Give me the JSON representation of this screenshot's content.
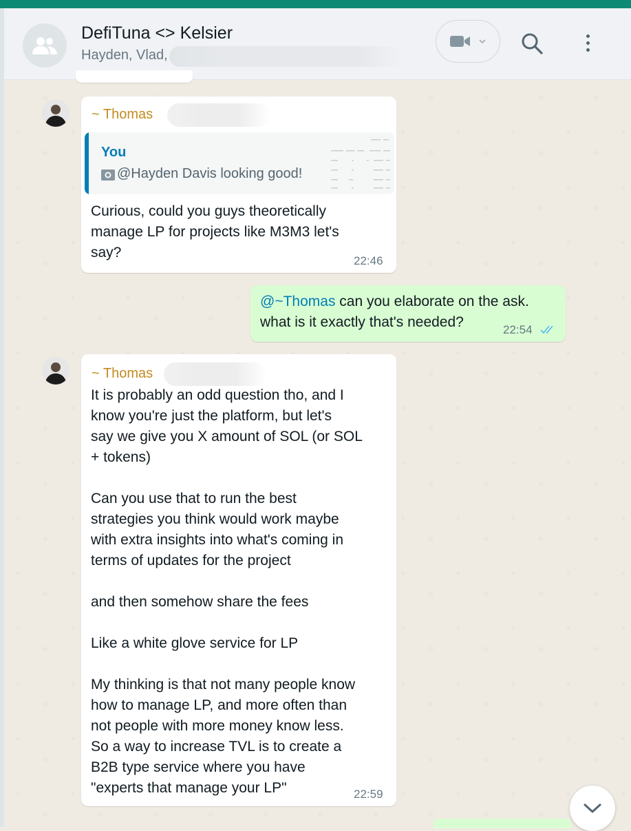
{
  "header": {
    "title": "DefiTuna <> Kelsier",
    "participants": "Hayden, Vlad,"
  },
  "icons": {
    "group_avatar": "group-icon",
    "video": "video-camera-icon",
    "dropdown": "chevron-down-icon",
    "search": "search-icon",
    "menu": "kebab-menu-icon",
    "scroll": "chevron-down-icon",
    "read_receipt": "double-check-icon"
  },
  "colors": {
    "accent": "#0d8a74",
    "incoming_bubble": "#ffffff",
    "outgoing_bubble": "#d9fdd3",
    "sender_name": "#c48a1f",
    "mention": "#027eb5",
    "read_tick": "#53bdeb"
  },
  "messages": [
    {
      "sender": "~ Thomas",
      "quote": {
        "author": "You",
        "text": "@Hayden Davis looking good!"
      },
      "text": "Curious, could you guys theoretically\nmanage LP for projects like M3M3 let's\nsay?",
      "time": "22:46"
    },
    {
      "mention": "@~Thomas",
      "text_line1": " can you elaborate on the ask.",
      "text_line2": "what is it exactly that's needed?",
      "time": "22:54"
    },
    {
      "sender": "~ Thomas",
      "text": "It is probably an odd question tho, and I\nknow you're just the platform, but let's\nsay we give you X amount of SOL (or SOL\n+ tokens)\n\nCan you use that to run the best\nstrategies you think would work maybe\nwith extra insights into what's coming in\nterms of updates for the project\n\nand then somehow share the fees\n\nLike a white glove service for LP\n\nMy thinking is that not many people know\nhow to manage LP, and more often than\nnot people with more money know less.\nSo a way to increase TVL is to create a\nB2B type service where you have\n\"experts that manage your LP\"",
      "time": "22:59"
    }
  ]
}
